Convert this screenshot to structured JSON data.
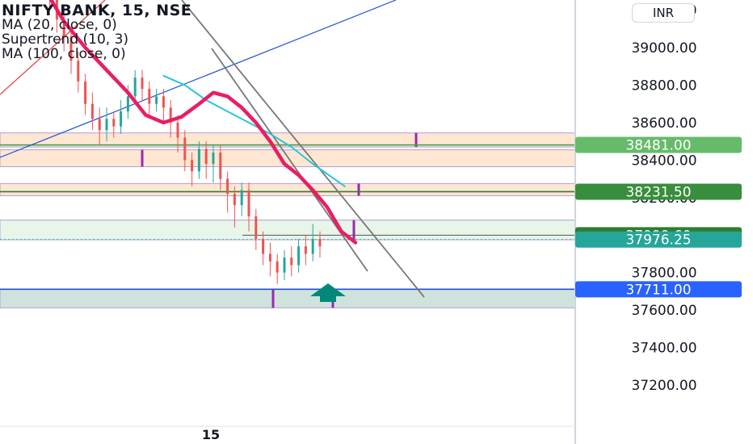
{
  "header": {
    "title": "NIFTY BANK, 15, NSE",
    "indicators": [
      "MA (20, close, 0)",
      "Supertrend (10, 3)",
      "MA (100, close, 0)"
    ],
    "currency": "INR"
  },
  "chart_data": {
    "type": "candlestick",
    "ylim": [
      37000,
      39700
    ],
    "price_axis_ticks": [
      39200,
      39000,
      38800,
      38600,
      38400,
      38200,
      37800,
      37600,
      37400,
      37200
    ],
    "price_axis_tick_labels": [
      "39200.00",
      "39000.00",
      "38800.00",
      "38600.00",
      "38400.00",
      "38200.00",
      "37800.00",
      "37600.00",
      "37400.00",
      "37200.00"
    ],
    "time_axis_labels": [
      "15"
    ],
    "price_labels": [
      {
        "value": 38481,
        "text": "38481.00",
        "color": "#66bb6a"
      },
      {
        "value": 38231.5,
        "text": "38231.50",
        "color": "#388e3c"
      },
      {
        "value": 37999.6,
        "text": "37999.60",
        "color": "#2e7d32"
      },
      {
        "value": 37976.25,
        "text": "37976.25",
        "color": "#26a69a"
      },
      {
        "value": 37711,
        "text": "37711.00",
        "color": "#2962ff"
      }
    ],
    "horizontal_levels": [
      {
        "value": 38481,
        "color": "#43a047"
      },
      {
        "value": 38231.5,
        "color": "#2e7d32"
      },
      {
        "value": 37711,
        "color": "#1e4fd8"
      }
    ],
    "zones": [
      {
        "top": 38545,
        "bottom": 38470,
        "fill": "#fde7d3"
      },
      {
        "top": 38455,
        "bottom": 38365,
        "fill": "#fde7d3"
      },
      {
        "top": 38275,
        "bottom": 38210,
        "fill": "#fde7d3"
      },
      {
        "top": 38080,
        "bottom": 37975,
        "fill": "#e8f5e9"
      },
      {
        "top": 37711,
        "bottom": 37612,
        "fill": "#cfe3dc"
      }
    ],
    "ma20": [
      [
        0,
        39520
      ],
      [
        12,
        39420
      ],
      [
        24,
        39330
      ],
      [
        36,
        39140
      ],
      [
        48,
        39000
      ],
      [
        60,
        38880
      ],
      [
        72,
        38760
      ],
      [
        82,
        38640
      ],
      [
        92,
        38600
      ],
      [
        102,
        38630
      ],
      [
        112,
        38700
      ],
      [
        120,
        38760
      ],
      [
        128,
        38740
      ],
      [
        136,
        38680
      ],
      [
        144,
        38600
      ],
      [
        152,
        38500
      ],
      [
        160,
        38380
      ],
      [
        168,
        38320
      ],
      [
        176,
        38240
      ],
      [
        184,
        38150
      ],
      [
        192,
        38020
      ],
      [
        200,
        37960
      ]
    ],
    "ma100": [
      [
        92,
        38850
      ],
      [
        104,
        38800
      ],
      [
        116,
        38720
      ],
      [
        128,
        38660
      ],
      [
        140,
        38600
      ],
      [
        152,
        38540
      ],
      [
        164,
        38470
      ],
      [
        176,
        38380
      ],
      [
        188,
        38300
      ],
      [
        194,
        38260
      ]
    ],
    "candles": [
      [
        0,
        39500,
        39580,
        39420,
        39600
      ],
      [
        4,
        39560,
        39520,
        39440,
        39640
      ],
      [
        8,
        39520,
        39480,
        39400,
        39600
      ],
      [
        12,
        39480,
        39400,
        39340,
        39560
      ],
      [
        16,
        39400,
        39460,
        39320,
        39520
      ],
      [
        20,
        39460,
        39380,
        39300,
        39500
      ],
      [
        24,
        39380,
        39330,
        39260,
        39440
      ],
      [
        28,
        39330,
        39280,
        39200,
        39400
      ],
      [
        32,
        39280,
        39150,
        39080,
        39320
      ],
      [
        36,
        39150,
        39060,
        38980,
        39200
      ],
      [
        40,
        39060,
        38930,
        38860,
        39100
      ],
      [
        44,
        38930,
        38820,
        38760,
        38980
      ],
      [
        48,
        38820,
        38700,
        38640,
        38860
      ],
      [
        52,
        38700,
        38620,
        38560,
        38760
      ],
      [
        56,
        38620,
        38560,
        38480,
        38680
      ],
      [
        60,
        38560,
        38620,
        38500,
        38680
      ],
      [
        64,
        38620,
        38580,
        38520,
        38660
      ],
      [
        68,
        38580,
        38660,
        38540,
        38720
      ],
      [
        72,
        38660,
        38740,
        38620,
        38800
      ],
      [
        76,
        38740,
        38840,
        38700,
        38880
      ],
      [
        80,
        38840,
        38780,
        38720,
        38880
      ],
      [
        84,
        38780,
        38700,
        38640,
        38820
      ],
      [
        88,
        38700,
        38740,
        38660,
        38780
      ],
      [
        92,
        38740,
        38680,
        38600,
        38780
      ],
      [
        96,
        38680,
        38600,
        38520,
        38720
      ],
      [
        100,
        38600,
        38520,
        38440,
        38640
      ],
      [
        104,
        38520,
        38400,
        38340,
        38560
      ],
      [
        108,
        38400,
        38340,
        38260,
        38440
      ],
      [
        112,
        38340,
        38460,
        38300,
        38500
      ],
      [
        116,
        38460,
        38380,
        38300,
        38500
      ],
      [
        120,
        38380,
        38440,
        38280,
        38480
      ],
      [
        124,
        38440,
        38300,
        38240,
        38480
      ],
      [
        128,
        38300,
        38220,
        38120,
        38340
      ],
      [
        132,
        38220,
        38160,
        38040,
        38260
      ],
      [
        136,
        38160,
        38240,
        38100,
        38280
      ],
      [
        140,
        38240,
        38100,
        38020,
        38280
      ],
      [
        144,
        38100,
        37980,
        37920,
        38140
      ],
      [
        148,
        37980,
        37900,
        37840,
        38020
      ],
      [
        152,
        37900,
        37860,
        37780,
        37960
      ],
      [
        156,
        37860,
        37800,
        37740,
        37900
      ],
      [
        160,
        37800,
        37880,
        37760,
        37920
      ],
      [
        164,
        37880,
        37840,
        37780,
        37940
      ],
      [
        168,
        37840,
        37940,
        37800,
        37980
      ],
      [
        172,
        37940,
        37900,
        37840,
        38000
      ],
      [
        176,
        37900,
        37980,
        37860,
        38060
      ],
      [
        180,
        37980,
        37940,
        37880,
        38020
      ]
    ]
  }
}
